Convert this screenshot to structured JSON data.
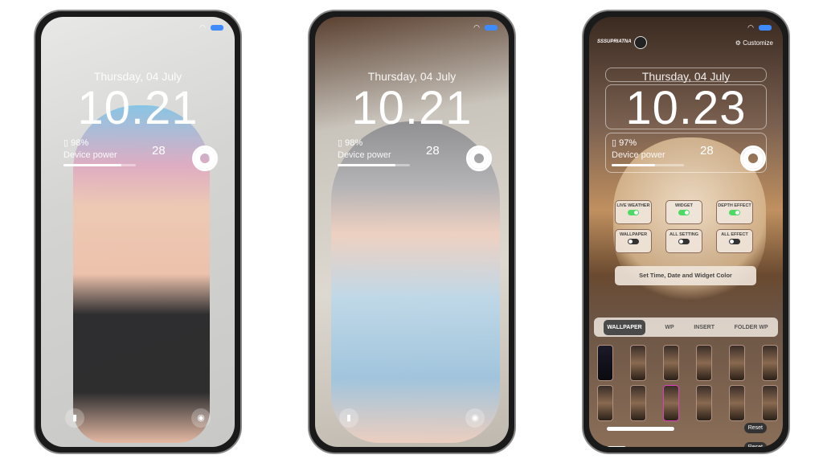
{
  "phones": [
    {
      "date": "Thursday, 04 July",
      "time": "10.21",
      "battery": "98%",
      "device_label": "Device power",
      "temp": "28",
      "progress": 0.8
    },
    {
      "date": "Thursday, 04 July",
      "time": "10.21",
      "battery": "98%",
      "device_label": "Device power",
      "temp": "28",
      "progress": 0.8
    },
    {
      "date": "Thursday, 04 July",
      "time": "10.23",
      "battery": "97%",
      "device_label": "Device power",
      "temp": "28",
      "progress": 0.6,
      "brand": "SSSUPRIATNA",
      "customize": "Customize",
      "toggles": [
        {
          "label": "LIVE WEATHER",
          "on": true
        },
        {
          "label": "WIDGET",
          "on": true
        },
        {
          "label": "DEPTH EFFECT",
          "on": true
        },
        {
          "label": "WALLPAPER",
          "on": false
        },
        {
          "label": "ALL SETTING",
          "on": false
        },
        {
          "label": "ALL EFFECT",
          "on": false
        }
      ],
      "set_color": "Set Time, Date and Widget Color",
      "tabs": [
        "WALLPAPER",
        "WP",
        "INSERT",
        "FOLDER WP"
      ],
      "active_tab": "WALLPAPER",
      "thumb_count": 12,
      "reset": "Reset"
    }
  ],
  "colors": {
    "battery_icon": "#3d8bfd",
    "toggle_on": "#4cd964"
  }
}
